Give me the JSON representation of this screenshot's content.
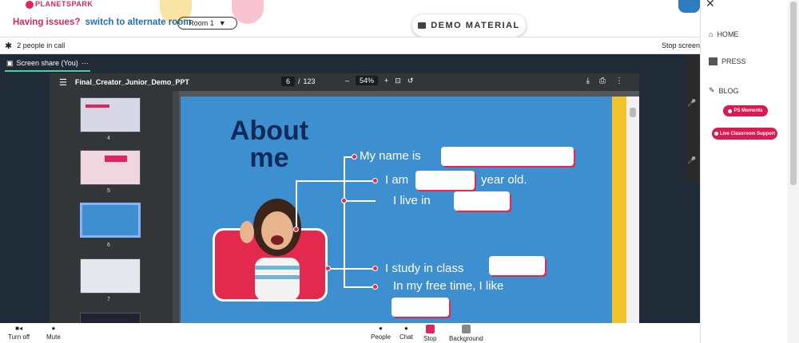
{
  "header": {
    "logo_text": "PLANETSPARK",
    "issue_question": "Having issues?",
    "switch_link": "switch to alternate room",
    "room_select": "Room 1",
    "demo_button": "DEMO MATERIAL"
  },
  "callbar": {
    "people_count": "2 people in call",
    "stop_screen": "Stop screen"
  },
  "share_tab": {
    "label": "Screen share (You)",
    "more": "···"
  },
  "pdf": {
    "filename": "Final_Creator_Junior_Demo_PPT",
    "page_current": "6",
    "page_sep": "/",
    "page_total": "123",
    "zoom_minus": "–",
    "zoom": "54%",
    "zoom_plus": "+",
    "thumb_numbers": [
      "4",
      "5",
      "6",
      "7"
    ]
  },
  "slide": {
    "title_line1": "About",
    "title_line2": "me",
    "line_name": "My name is",
    "line_am": "I am",
    "line_year": "year old.",
    "line_live": "I live in",
    "line_study": "I study in class",
    "line_free": "In my free time, I like"
  },
  "right_panel": {
    "home": "HOME",
    "press": "PRESS",
    "blog": "BLOG",
    "ps_moments": "PS Moments",
    "live_support": "Live Classroom Support"
  },
  "bottom": {
    "turn_off": "Turn off",
    "mute": "Mute",
    "people": "People",
    "chat": "Chat",
    "stop": "Stop",
    "background": "Background"
  },
  "colors": {
    "brand_pink": "#e0245e",
    "link_blue": "#1e6fb8",
    "slide_blue": "#3d8fcf",
    "slide_yellow": "#f0c32b"
  }
}
